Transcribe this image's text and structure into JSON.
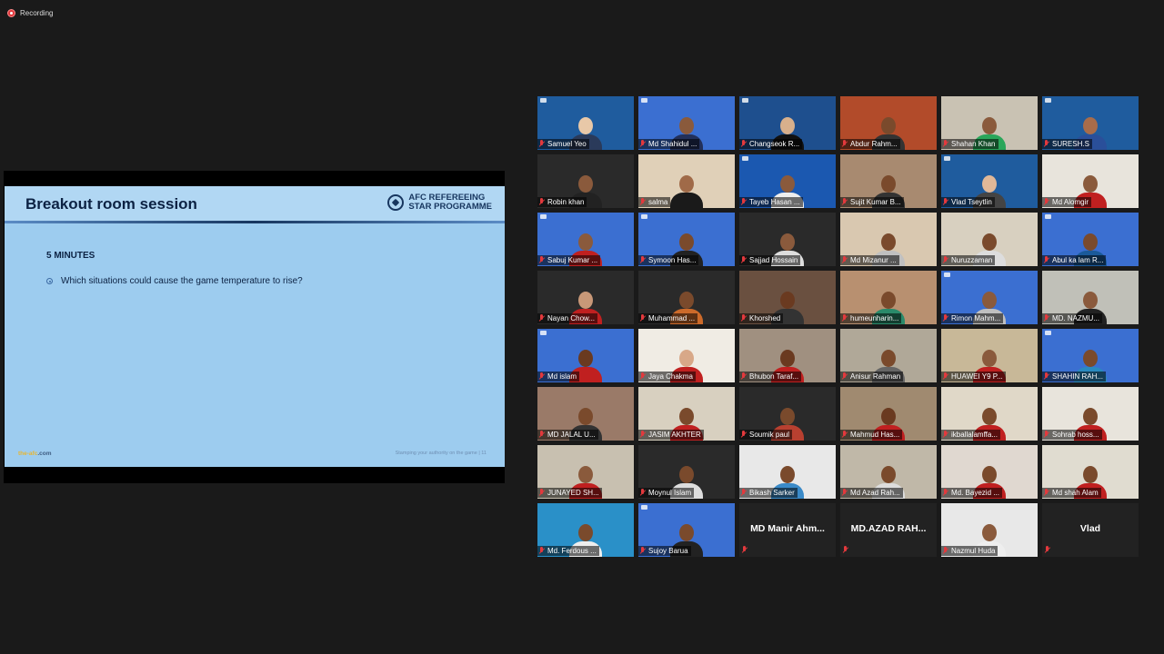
{
  "recording": {
    "label": "Recording"
  },
  "slide": {
    "title": "Breakout room session",
    "brand_line1": "AFC REFEREEING",
    "brand_line2": "STAR PROGRAMME",
    "minutes": "5 MINUTES",
    "bullet": "Which situations could cause the game temperature to rise?",
    "footer_left_a": "the-afc",
    "footer_left_b": ".com",
    "footer_right": "Stamping your authority on the game  |  11"
  },
  "participants": [
    {
      "name": "Samuel Yeo",
      "bg": "#1f5c9e",
      "skin": "#e8c8a8",
      "shirt": "#2a3a5a",
      "badge": true
    },
    {
      "name": "Md Shahidul ...",
      "bg": "#3b6fd1",
      "skin": "#8a5a3c",
      "shirt": "#22305a",
      "badge": true
    },
    {
      "name": "Changseok R...",
      "bg": "#1e4f8e",
      "skin": "#d8b08c",
      "shirt": "#111",
      "badge": true
    },
    {
      "name": "Abdur Rahm...",
      "bg": "#b24b2a",
      "skin": "#7a4a2c",
      "shirt": "#333",
      "badge": false
    },
    {
      "name": "Shahan Khan",
      "bg": "#c9c2b3",
      "skin": "#8a5a3c",
      "shirt": "#2aa65a",
      "badge": false
    },
    {
      "name": "SURESH.S",
      "bg": "#1f5c9e",
      "skin": "#a86c4a",
      "shirt": "#2a4f9a",
      "badge": true,
      "active": true
    },
    {
      "name": "Robin khan",
      "bg": "#2a2a2a",
      "skin": "#8a5a3c",
      "shirt": "#222",
      "badge": false
    },
    {
      "name": "salma",
      "bg": "#e0d0b8",
      "skin": "#a06a48",
      "shirt": "#1a1a1a",
      "badge": false
    },
    {
      "name": "Tayeb Hasan ...",
      "bg": "#1b58b0",
      "skin": "#8a5a3c",
      "shirt": "#eee",
      "badge": true
    },
    {
      "name": "Sujit Kumar B...",
      "bg": "#a88a70",
      "skin": "#7a4a2c",
      "shirt": "#333",
      "badge": false
    },
    {
      "name": "Vlad Tseytlin",
      "bg": "#1f5c9e",
      "skin": "#e0b898",
      "shirt": "#444",
      "badge": true
    },
    {
      "name": "Md Alomgir",
      "bg": "#e8e4dc",
      "skin": "#8a5a3c",
      "shirt": "#c02020",
      "badge": false
    },
    {
      "name": "Sabuj Kumar ...",
      "bg": "#3b6fd1",
      "skin": "#8a5a3c",
      "shirt": "#c02020",
      "badge": true
    },
    {
      "name": "Symoon Has...",
      "bg": "#3b6fd1",
      "skin": "#7a4a2c",
      "shirt": "#222",
      "badge": true
    },
    {
      "name": "Sajjad Hossain",
      "bg": "#2a2a2a",
      "skin": "#8a5a3c",
      "shirt": "#ddd",
      "badge": false
    },
    {
      "name": "Md Mizanur ...",
      "bg": "#d9c8b0",
      "skin": "#7a4a2c",
      "shirt": "#c0c0c0",
      "badge": false
    },
    {
      "name": "Nuruzzaman",
      "bg": "#d8d0c0",
      "skin": "#7a4a2c",
      "shirt": "#ddd",
      "badge": false
    },
    {
      "name": "Abul ka lam R...",
      "bg": "#3b6fd1",
      "skin": "#7a4a2c",
      "shirt": "#1a5a9a",
      "badge": true
    },
    {
      "name": "Nayan Chow...",
      "bg": "#2a2a2a",
      "skin": "#c89878",
      "shirt": "#c02020",
      "badge": false
    },
    {
      "name": "Muhammad ...",
      "bg": "#2a2a2a",
      "skin": "#7a4a2c",
      "shirt": "#cc6a2a",
      "badge": false
    },
    {
      "name": "Khorshed",
      "bg": "#6a5040",
      "skin": "#6a3a20",
      "shirt": "#333",
      "badge": false
    },
    {
      "name": "humeunharin...",
      "bg": "#b89070",
      "skin": "#7a4a2c",
      "shirt": "#2a8a6a",
      "badge": false
    },
    {
      "name": "Rimon Mahm...",
      "bg": "#3b6fd1",
      "skin": "#8a5a3c",
      "shirt": "#c0c0c0",
      "badge": true
    },
    {
      "name": "MD. NAZMU...",
      "bg": "#c0c0b8",
      "skin": "#8a5a3c",
      "shirt": "#222",
      "badge": false
    },
    {
      "name": "Md islam",
      "bg": "#3b6fd1",
      "skin": "#6a3a20",
      "shirt": "#c02020",
      "badge": true
    },
    {
      "name": "Jaya Chakma",
      "bg": "#f0ece4",
      "skin": "#d8a888",
      "shirt": "#c02020",
      "badge": false
    },
    {
      "name": "Bhubon Taraf...",
      "bg": "#a09080",
      "skin": "#6a3a20",
      "shirt": "#c02020",
      "badge": false
    },
    {
      "name": "Anisur Rahman",
      "bg": "#b0a898",
      "skin": "#7a4a2c",
      "shirt": "#666",
      "badge": false
    },
    {
      "name": "HUAWEI Y9 P...",
      "bg": "#c8b898",
      "skin": "#8a5a3c",
      "shirt": "#c02020",
      "badge": false
    },
    {
      "name": "SHAHIN RAH...",
      "bg": "#3b6fd1",
      "skin": "#7a4a2c",
      "shirt": "#2a8ac0",
      "badge": true
    },
    {
      "name": "MD JALAL U...",
      "bg": "#9a7a68",
      "skin": "#7a4a2c",
      "shirt": "#333",
      "badge": false
    },
    {
      "name": "JASIM AKHTER",
      "bg": "#d8d0c0",
      "skin": "#7a4a2c",
      "shirt": "#c02020",
      "badge": false
    },
    {
      "name": "Soumik paul",
      "bg": "#2a2a2a",
      "skin": "#7a4a2c",
      "shirt": "#b84030",
      "badge": false
    },
    {
      "name": "Mahmud Has...",
      "bg": "#a08a70",
      "skin": "#6a3a20",
      "shirt": "#c02020",
      "badge": false
    },
    {
      "name": "ikballalamffa...",
      "bg": "#e0d8c8",
      "skin": "#7a4a2c",
      "shirt": "#c02020",
      "badge": false
    },
    {
      "name": "Sohrab hoss...",
      "bg": "#e8e4dc",
      "skin": "#7a4a2c",
      "shirt": "#c02020",
      "badge": false
    },
    {
      "name": "JUNAYED SH...",
      "bg": "#c8c0b0",
      "skin": "#8a5a3c",
      "shirt": "#c02020",
      "badge": false
    },
    {
      "name": "Moynul Islam",
      "bg": "#2a2a2a",
      "skin": "#7a4a2c",
      "shirt": "#ddd",
      "badge": false
    },
    {
      "name": "Bikash Sarker",
      "bg": "#e8e8e8",
      "skin": "#7a4a2c",
      "shirt": "#3a8ac8",
      "badge": false
    },
    {
      "name": "Md Azad Rah...",
      "bg": "#c0b8a8",
      "skin": "#7a4a2c",
      "shirt": "#ddd",
      "badge": false
    },
    {
      "name": "Md. Bayezid ...",
      "bg": "#e0d8d0",
      "skin": "#7a4a2c",
      "shirt": "#c02020",
      "badge": false
    },
    {
      "name": "Md shah Alam",
      "bg": "#e0dcd0",
      "skin": "#7a4a2c",
      "shirt": "#c02020",
      "badge": false
    },
    {
      "name": "Md. Ferdous ...",
      "bg": "#2a90c8",
      "skin": "#7a4a2c",
      "shirt": "#eee",
      "badge": false
    },
    {
      "name": "Sujoy Barua",
      "bg": "#3b6fd1",
      "skin": "#7a4a2c",
      "shirt": "#222",
      "badge": true
    },
    {
      "name": "MD Manir Ahm...",
      "novideo": true
    },
    {
      "name": "MD.AZAD RAH...",
      "novideo": true
    },
    {
      "name": "Nazmul Huda",
      "bg": "#e8e8e8",
      "skin": "#8a5a3c",
      "shirt": "#eee",
      "badge": false
    },
    {
      "name": "Vlad",
      "novideo": true
    }
  ]
}
